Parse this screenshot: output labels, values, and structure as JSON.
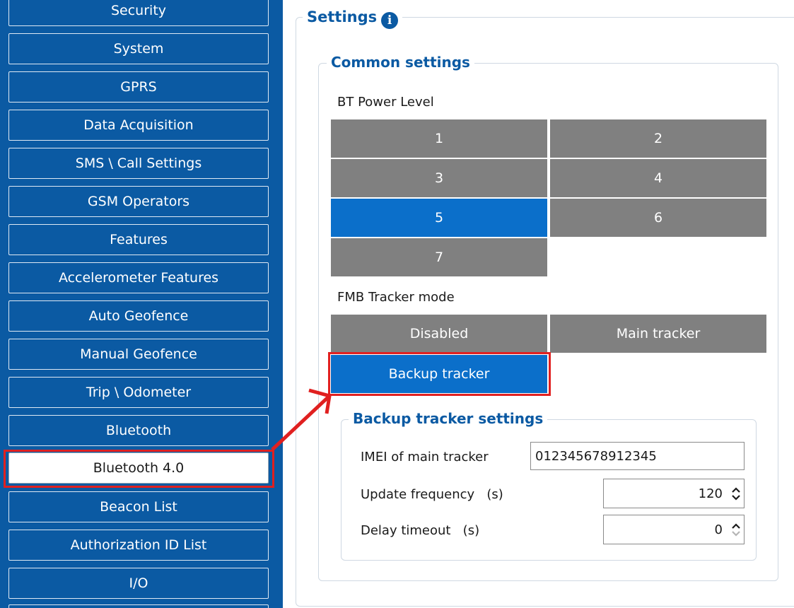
{
  "sidebar": {
    "items": [
      {
        "label": "Security"
      },
      {
        "label": "System"
      },
      {
        "label": "GPRS"
      },
      {
        "label": "Data Acquisition"
      },
      {
        "label": "SMS \\ Call Settings"
      },
      {
        "label": "GSM Operators"
      },
      {
        "label": "Features"
      },
      {
        "label": "Accelerometer Features"
      },
      {
        "label": "Auto Geofence"
      },
      {
        "label": "Manual Geofence"
      },
      {
        "label": "Trip \\ Odometer"
      },
      {
        "label": "Bluetooth"
      },
      {
        "label": "Bluetooth 4.0"
      },
      {
        "label": "Beacon List"
      },
      {
        "label": "Authorization ID List"
      },
      {
        "label": "I/O"
      }
    ],
    "active_item": "Bluetooth 4.0"
  },
  "settings": {
    "title": "Settings",
    "info_icon": "i",
    "common": {
      "title": "Common settings",
      "bt_power_level": {
        "label": "BT Power Level",
        "options": [
          "1",
          "2",
          "3",
          "4",
          "5",
          "6",
          "7"
        ],
        "selected": "5"
      },
      "tracker_mode": {
        "label": "FMB Tracker mode",
        "options": [
          "Disabled",
          "Main tracker",
          "Backup tracker"
        ],
        "selected": "Backup tracker"
      }
    },
    "backup": {
      "title": "Backup tracker settings",
      "imei_label": "IMEI of main tracker",
      "imei_value": "012345678912345",
      "update_label": "Update frequency",
      "update_unit": "(s)",
      "update_value": "120",
      "delay_label": "Delay timeout",
      "delay_unit": "(s)",
      "delay_value": "0"
    }
  },
  "colors": {
    "sidebar_bg": "#0b5aa3",
    "tile_gray": "#808080",
    "tile_selected": "#0b6fca",
    "group_title": "#0b5aa3",
    "annotation_red": "#e02020"
  }
}
